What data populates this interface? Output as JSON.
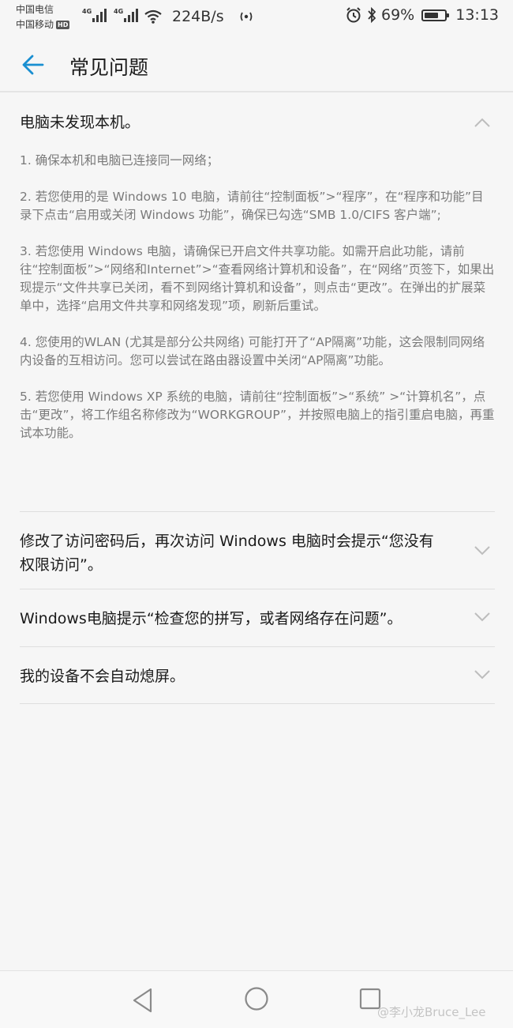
{
  "status": {
    "carrier1": "中国电信",
    "carrier2": "中国移动",
    "hd_badge": "HD",
    "net_type1": "4G",
    "net_type2": "4G",
    "speed": "224B/s",
    "battery_pct": "69%",
    "battery_level": 0.69,
    "time": "13:13"
  },
  "appbar": {
    "title": "常见问题"
  },
  "faq": [
    {
      "question": "电脑未发现本机。",
      "expanded": true,
      "answer": [
        "1. 确保本机和电脑已连接同一网络；",
        "2. 若您使用的是 Windows 10 电脑，请前往“控制面板”>“程序”，在“程序和功能”目录下点击“启用或关闭 Windows 功能”，确保已勾选“SMB 1.0/CIFS 客户端”;",
        "3. 若您使用 Windows 电脑，请确保已开启文件共享功能。如需开启此功能，请前往“控制面板”>“网络和Internet”>“查看网络计算机和设备”，在“网络”页签下，如果出现提示“文件共享已关闭，看不到网络计算机和设备”，则点击“更改”。在弹出的扩展菜单中，选择“启用文件共享和网络发现”项，刷新后重试。",
        "4. 您使用的WLAN (尤其是部分公共网络) 可能打开了“AP隔离”功能，这会限制同网络内设备的互相访问。您可以尝试在路由器设置中关闭“AP隔离”功能。",
        "5. 若您使用 Windows XP 系统的电脑，请前往“控制面板”>“系统” >“计算机名”，点击“更改”，将工作组名称修改为“WORKGROUP”，并按照电脑上的指引重启电脑，再重试本功能。"
      ]
    },
    {
      "question": "修改了访问密码后，再次访问 Windows 电脑时会提示“您没有权限访问”。",
      "expanded": false
    },
    {
      "question": "Windows电脑提示“检查您的拼写，或者网络存在问题”。",
      "expanded": false
    },
    {
      "question": "我的设备不会自动熄屏。",
      "expanded": false
    }
  ],
  "watermark": "@李小龙Bruce_Lee",
  "colors": {
    "accent": "#1a8fd1",
    "background": "#f6f6f6",
    "answer_text": "#7a7a7a"
  }
}
